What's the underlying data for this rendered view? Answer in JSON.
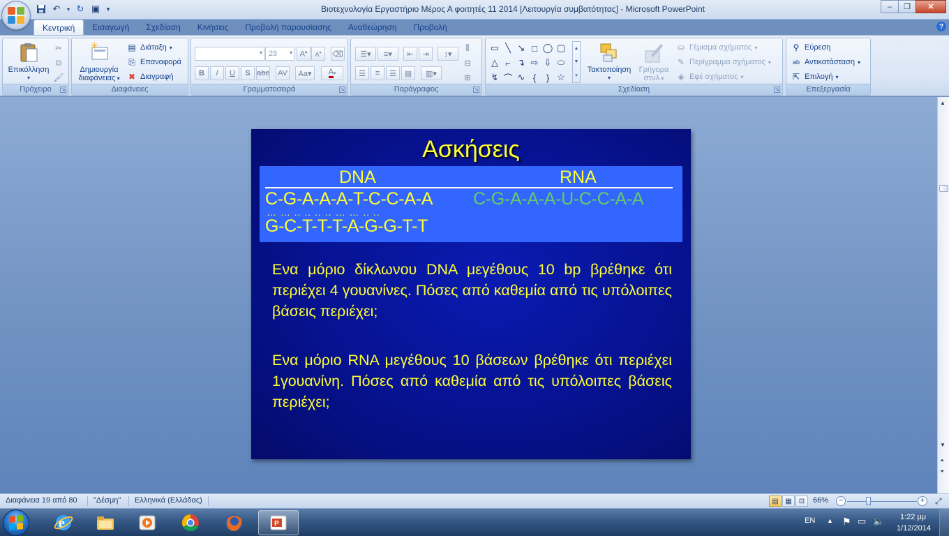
{
  "window": {
    "title": "Βιοτεχνολογία Εργαστήριο Μέρος Α φοιτητές 11 2014 [Λειτουργία συμβατότητας] - Microsoft PowerPoint",
    "minimize": "–",
    "maximize": "❐",
    "close": "✕"
  },
  "tabs": [
    {
      "label": "Κεντρική"
    },
    {
      "label": "Εισαγωγή"
    },
    {
      "label": "Σχεδίαση"
    },
    {
      "label": "Κινήσεις"
    },
    {
      "label": "Προβολή παρουσίασης"
    },
    {
      "label": "Αναθεώρηση"
    },
    {
      "label": "Προβολή"
    }
  ],
  "ribbon": {
    "clipboard": {
      "label": "Πρόχειρο",
      "paste": "Επικόλληση"
    },
    "slides": {
      "label": "Διαφάνειες",
      "new_slide_1": "Δημιουργία",
      "new_slide_2": "διαφάνειας",
      "layout": "Διάταξη",
      "reset": "Επαναφορά",
      "delete": "Διαγραφή"
    },
    "font": {
      "label": "Γραμματοσειρά",
      "size": "28"
    },
    "paragraph": {
      "label": "Παράγραφος"
    },
    "drawing": {
      "label": "Σχεδίαση",
      "arrange": "Τακτοποίηση",
      "quick_styles_1": "Γρήγορα",
      "quick_styles_2": "στυλ",
      "shape_fill": "Γέμισμα σχήματος",
      "shape_outline": "Περίγραμμα σχήματος",
      "shape_effects": "Εφέ σχήματος"
    },
    "editing": {
      "label": "Επεξεργασία",
      "find": "Εύρεση",
      "replace": "Αντικατάσταση",
      "select": "Επιλογή"
    }
  },
  "slide": {
    "title": "Ασκήσεις",
    "dna_header": "DNA",
    "rna_header": "RNA",
    "dna_strand_1": "C-G-A-A-A-T-C-C-A-A",
    "dna_pairs": "… … .. .. .. .. … … .. ..",
    "dna_strand_2": "G-C-T-T-T-A-G-G-T-T",
    "rna_strand": "C-G-A-A-A-U-C-C-A-A",
    "question_1": "Ενα μόριο δίκλωνου DNA μεγέθους 10 bp βρέθηκε ότι περιέχει 4 γουανίνες. Πόσες από καθεμία από τις υπόλοιπες βάσεις περιέχει;",
    "question_2": "Ενα μόριο RNA μεγέθους 10 βάσεων βρέθηκε ότι περιέχει 1γουανίνη. Πόσες από καθεμία από τις υπόλοιπες βάσεις περιέχει;"
  },
  "status": {
    "slide_count": "Διαφάνεια 19 από 80",
    "theme": "\"Δέσμη\"",
    "language": "Ελληνικά (Ελλάδας)",
    "zoom": "66%",
    "zoom_level_percent": 66
  },
  "taskbar": {
    "lang": "EN",
    "time": "1:22 μμ",
    "date": "1/12/2014"
  },
  "colors": {
    "slide_bg": "#06128f",
    "slide_text": "#ffff33",
    "seq_box": "#3366ff",
    "rna_text": "#66cc66"
  }
}
